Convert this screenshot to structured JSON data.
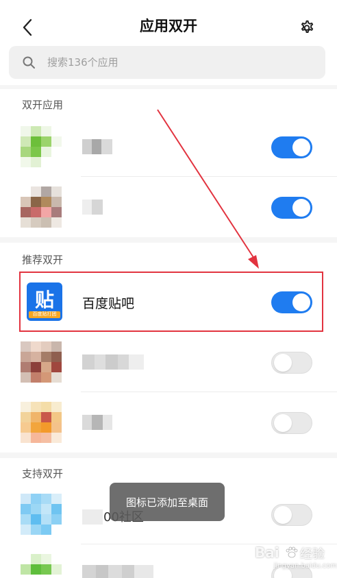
{
  "header": {
    "title": "应用双开"
  },
  "search": {
    "placeholder": "搜索136个应用"
  },
  "sections": {
    "dual": "双开应用",
    "recommended": "推荐双开",
    "supported": "支持双开"
  },
  "highlighted_app": {
    "name": "百度贴吧",
    "icon_glyph": "贴",
    "icon_band": "百度贴打团",
    "enabled": true
  },
  "toggles": [
    {
      "enabled": true
    },
    {
      "enabled": true
    },
    {
      "enabled": true
    },
    {
      "enabled": false
    },
    {
      "enabled": false
    },
    {
      "enabled": false
    },
    {
      "enabled": false
    }
  ],
  "toast": "图标已添加至桌面",
  "partial_app_name": "00社区",
  "watermark": {
    "brand": "Bai",
    "brand2": "经验",
    "url": "jingyan.baidu.com"
  },
  "colors": {
    "toggle_on": "#1f7cf0",
    "highlight_border": "#e2333f",
    "arrow": "#e2333f"
  },
  "icons": {
    "back": "chevron-left-icon",
    "settings": "gear-icon",
    "search": "search-icon"
  }
}
